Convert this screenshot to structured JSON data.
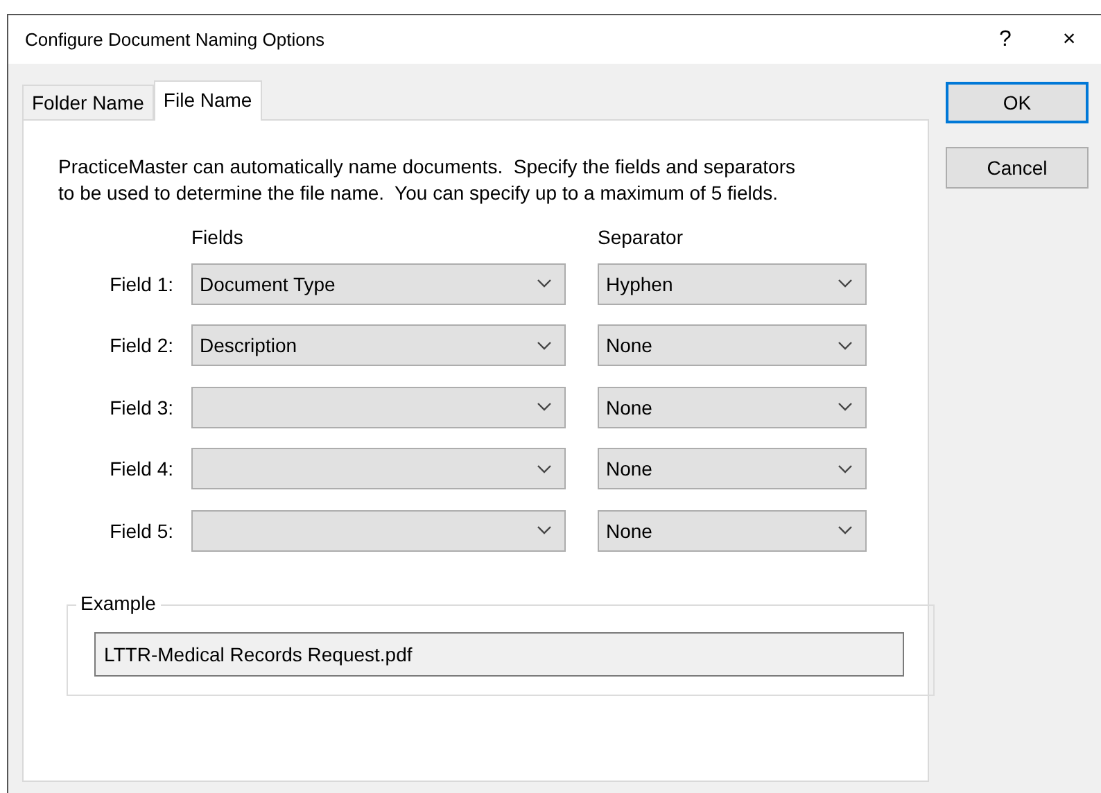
{
  "window": {
    "title": "Configure Document Naming Options",
    "help": "?",
    "close": "×"
  },
  "tabs": [
    {
      "label": "Folder Name",
      "selected": false
    },
    {
      "label": "File Name",
      "selected": true
    }
  ],
  "intro": "PracticeMaster can automatically name documents.  Specify the fields and separators to be used to determine the file name.  You can specify up to a maximum of 5 fields.",
  "columns": {
    "fields": "Fields",
    "separator": "Separator"
  },
  "rows": [
    {
      "label": "Field 1:",
      "field": "Document Type",
      "separator": "Hyphen"
    },
    {
      "label": "Field 2:",
      "field": "Description",
      "separator": "None"
    },
    {
      "label": "Field 3:",
      "separator": "None"
    },
    {
      "label": "Field 4:",
      "separator": "None"
    },
    {
      "label": "Field 5:",
      "separator": "None"
    }
  ],
  "example": {
    "legend": "Example",
    "value": "LTTR-Medical Records Request.pdf"
  },
  "buttons": [
    {
      "label": "OK",
      "default": true
    },
    {
      "label": "Cancel",
      "default": false
    }
  ]
}
